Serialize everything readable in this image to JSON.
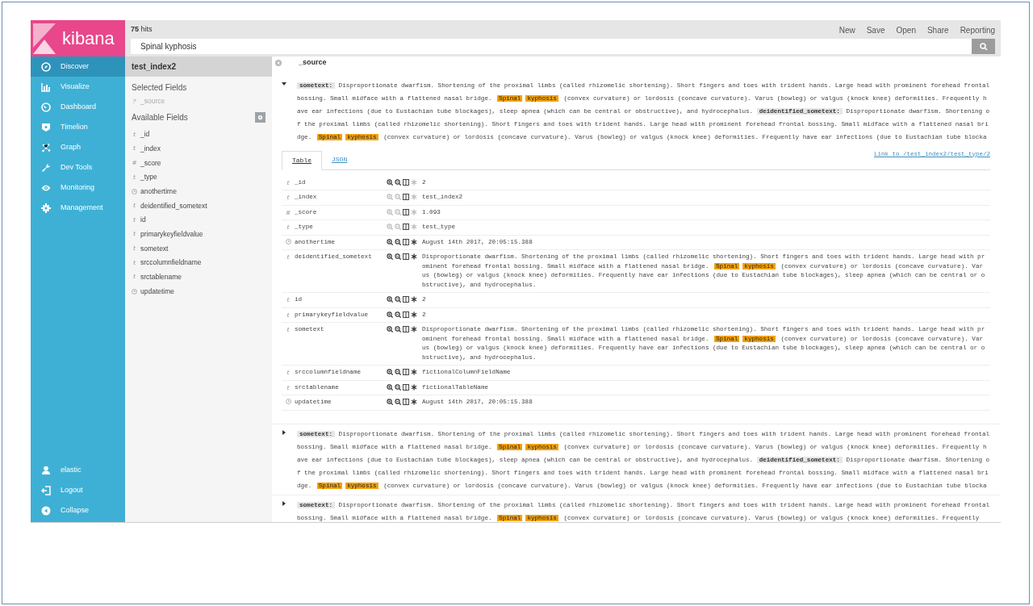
{
  "logo": {
    "text": "kibana"
  },
  "nav": [
    {
      "label": "Discover",
      "selected": true
    },
    {
      "label": "Visualize",
      "selected": false
    },
    {
      "label": "Dashboard",
      "selected": false
    },
    {
      "label": "Timelion",
      "selected": false
    },
    {
      "label": "Graph",
      "selected": false
    },
    {
      "label": "Dev Tools",
      "selected": false
    },
    {
      "label": "Monitoring",
      "selected": false
    },
    {
      "label": "Management",
      "selected": false
    }
  ],
  "nav_footer": [
    {
      "label": "elastic"
    },
    {
      "label": "Logout"
    },
    {
      "label": "Collapse"
    }
  ],
  "hits": "**75** hits",
  "menu": [
    "New",
    "Save",
    "Open",
    "Share",
    "Reporting"
  ],
  "search": {
    "value": "Spinal kyphosis"
  },
  "index_pattern": "test_index2",
  "selected_fields_title": "Selected Fields",
  "selected_fields": [
    {
      "kind": "glyph",
      "glyph": "?",
      "name": "_source"
    }
  ],
  "available_fields_title": "Available Fields",
  "available_fields": [
    {
      "kind": "glyph",
      "glyph": "t",
      "name": "_id"
    },
    {
      "kind": "glyph",
      "glyph": "t",
      "name": "_index"
    },
    {
      "kind": "glyph",
      "glyph": "#",
      "name": "_score"
    },
    {
      "kind": "glyph",
      "glyph": "t",
      "name": "_type"
    },
    {
      "kind": "date",
      "name": "anothertime"
    },
    {
      "kind": "glyph",
      "glyph": "t",
      "name": "deidentified_sometext"
    },
    {
      "kind": "glyph",
      "glyph": "t",
      "name": "id"
    },
    {
      "kind": "glyph",
      "glyph": "t",
      "name": "primarykeyfieldvalue"
    },
    {
      "kind": "glyph",
      "glyph": "t",
      "name": "sometext"
    },
    {
      "kind": "glyph",
      "glyph": "t",
      "name": "srccolumnfieldname"
    },
    {
      "kind": "glyph",
      "glyph": "t",
      "name": "srctablename"
    },
    {
      "kind": "date",
      "name": "updatetime"
    }
  ],
  "column_header": "_source",
  "documents": [
    {
      "expanded": true,
      "summary": [
        {
          "kind": "label",
          "text": "sometext:"
        },
        {
          "kind": "text",
          "text": " Disproportionate dwarfism. Shortening of the proximal limbs (called rhizomelic shortening). Short fingers and toes with trident hands. Large head with prominent forehead frontal bossing. Small midface with a flattened nasal bridge. "
        },
        {
          "kind": "hit",
          "text": "Spinal"
        },
        {
          "kind": "hit",
          "text": "kyphosis"
        },
        {
          "kind": "text",
          "text": " (convex curvature) or lordosis (concave curvature). Varus (bowleg) or valgus (knock knee) deformities. Frequently have ear infections (due to Eustachian tube blockages), sleep apnea (which can be central or obstructive), and hydrocephalus. "
        },
        {
          "kind": "label",
          "text": "deidentified_sometext:"
        },
        {
          "kind": "text",
          "text": " Disproportionate dwarfism. Shortening of the proximal limbs (called rhizomelic shortening). Short fingers and toes with trident hands. Large head with prominent forehead frontal bossing. Small midface with a flattened nasal bridge. "
        },
        {
          "kind": "hit",
          "text": "Spinal"
        },
        {
          "kind": "hit",
          "text": "kyphosis"
        },
        {
          "kind": "text",
          "text": " (convex curvature) or lordosis (concave curvature). Varus (bowleg) or valgus (knock knee) deformities. Frequently have ear infections (due to Eustachian tube blocka"
        }
      ],
      "tabs": [
        {
          "label": "Table",
          "selected": true
        },
        {
          "label": "JSON",
          "selected": false
        }
      ],
      "link": "Link to /test_index2/test_type/2",
      "rows": [
        {
          "kind": "glyph",
          "glyph": "t",
          "field": "_id",
          "filter_enabled": true,
          "exists_enabled": false,
          "value": [
            {
              "kind": "text",
              "text": "2"
            }
          ]
        },
        {
          "kind": "glyph",
          "glyph": "t",
          "field": "_index",
          "filter_enabled": false,
          "exists_enabled": false,
          "value": [
            {
              "kind": "text",
              "text": "test_index2"
            }
          ]
        },
        {
          "kind": "glyph",
          "glyph": "#",
          "field": "_score",
          "filter_enabled": false,
          "exists_enabled": false,
          "value": [
            {
              "kind": "text",
              "text": "1.093"
            }
          ]
        },
        {
          "kind": "glyph",
          "glyph": "t",
          "field": "_type",
          "filter_enabled": false,
          "exists_enabled": false,
          "value": [
            {
              "kind": "text",
              "text": "test_type"
            }
          ]
        },
        {
          "kind": "date",
          "field": "anothertime",
          "filter_enabled": true,
          "exists_enabled": true,
          "value": [
            {
              "kind": "text",
              "text": "August 14th 2017, 20:05:15.388"
            }
          ]
        },
        {
          "kind": "glyph",
          "glyph": "t",
          "field": "deidentified_sometext",
          "filter_enabled": true,
          "exists_enabled": true,
          "value": [
            {
              "kind": "text",
              "text": " Disproportionate dwarfism. Shortening of the proximal limbs (called rhizomelic shortening). Short fingers and toes with trident hands. Large head with prominent forehead frontal bossing. Small midface with a flattened nasal bridge. "
            },
            {
              "kind": "hit",
              "text": "Spinal"
            },
            {
              "kind": "hit",
              "text": "kyphosis"
            },
            {
              "kind": "text",
              "text": " (convex curvature) or lordosis (concave curvature). Varus (bowleg) or valgus (knock knee) deformities. Frequently have ear infections (due to Eustachian tube blockages), sleep apnea (which can be central or obstructive), and hydrocephalus."
            }
          ]
        },
        {
          "kind": "glyph",
          "glyph": "t",
          "field": "id",
          "filter_enabled": true,
          "exists_enabled": true,
          "value": [
            {
              "kind": "text",
              "text": "2"
            }
          ]
        },
        {
          "kind": "glyph",
          "glyph": "t",
          "field": "primarykeyfieldvalue",
          "filter_enabled": true,
          "exists_enabled": true,
          "value": [
            {
              "kind": "text",
              "text": "2"
            }
          ]
        },
        {
          "kind": "glyph",
          "glyph": "t",
          "field": "sometext",
          "filter_enabled": true,
          "exists_enabled": true,
          "value": [
            {
              "kind": "text",
              "text": " Disproportionate dwarfism. Shortening of the proximal limbs (called rhizomelic shortening). Short fingers and toes with trident hands. Large head with prominent forehead frontal bossing. Small midface with a flattened nasal bridge. "
            },
            {
              "kind": "hit",
              "text": "Spinal"
            },
            {
              "kind": "hit",
              "text": "kyphosis"
            },
            {
              "kind": "text",
              "text": " (convex curvature) or lordosis (concave curvature). Varus (bowleg) or valgus (knock knee) deformities. Frequently have ear infections (due to Eustachian tube blockages), sleep apnea (which can be central or obstructive), and hydrocephalus."
            }
          ]
        },
        {
          "kind": "glyph",
          "glyph": "t",
          "field": "srccolumnfieldname",
          "filter_enabled": true,
          "exists_enabled": true,
          "value": [
            {
              "kind": "text",
              "text": "fictionalColumnFieldName"
            }
          ]
        },
        {
          "kind": "glyph",
          "glyph": "t",
          "field": "srctablename",
          "filter_enabled": true,
          "exists_enabled": true,
          "value": [
            {
              "kind": "text",
              "text": "fictionalTableName"
            }
          ]
        },
        {
          "kind": "date",
          "field": "updatetime",
          "filter_enabled": true,
          "exists_enabled": true,
          "value": [
            {
              "kind": "text",
              "text": "August 14th 2017, 20:05:15.388"
            }
          ]
        }
      ]
    },
    {
      "expanded": false,
      "summary": [
        {
          "kind": "label",
          "text": "sometext:"
        },
        {
          "kind": "text",
          "text": " Disproportionate dwarfism. Shortening of the proximal limbs (called rhizomelic shortening). Short fingers and toes with trident hands. Large head with prominent forehead frontal bossing. Small midface with a flattened nasal bridge. "
        },
        {
          "kind": "hit",
          "text": "Spinal"
        },
        {
          "kind": "hit",
          "text": "kyphosis"
        },
        {
          "kind": "text",
          "text": " (convex curvature) or lordosis (concave curvature). Varus (bowleg) or valgus (knock knee) deformities. Frequently have ear infections (due to Eustachian tube blockages), sleep apnea (which can be central or obstructive), and hydrocephalus. "
        },
        {
          "kind": "label",
          "text": "deidentified_sometext:"
        },
        {
          "kind": "text",
          "text": " Disproportionate dwarfism. Shortening of the proximal limbs (called rhizomelic shortening). Short fingers and toes with trident hands. Large head with prominent forehead frontal bossing. Small midface with a flattened nasal bridge. "
        },
        {
          "kind": "hit",
          "text": "Spinal"
        },
        {
          "kind": "hit",
          "text": "kyphosis"
        },
        {
          "kind": "text",
          "text": " (convex curvature) or lordosis (concave curvature). Varus (bowleg) or valgus (knock knee) deformities. Frequently have ear infections (due to Eustachian tube blocka"
        }
      ]
    },
    {
      "expanded": false,
      "summary": [
        {
          "kind": "label",
          "text": "sometext:"
        },
        {
          "kind": "text",
          "text": " Disproportionate dwarfism. Shortening of the proximal limbs (called rhizomelic shortening). Short fingers and toes with trident hands. Large head with prominent forehead frontal bossing. Small midface with a flattened nasal bridge. "
        },
        {
          "kind": "hit",
          "text": "Spinal"
        },
        {
          "kind": "hit",
          "text": "kyphosis"
        },
        {
          "kind": "text",
          "text": " (convex curvature) or lordosis (concave curvature). Varus (bowleg) or valgus (knock knee) deformities. Frequently"
        }
      ]
    }
  ]
}
